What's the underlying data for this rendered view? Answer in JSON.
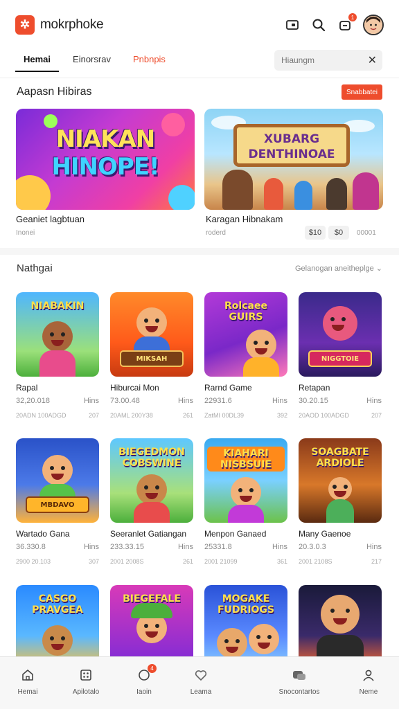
{
  "header": {
    "logo_glyph": "✲",
    "brand": "mokrphoke",
    "notification_count": "1",
    "accent": "#ee4d2d"
  },
  "tabs": [
    {
      "label": "Hemai"
    },
    {
      "label": "Einorsrav"
    },
    {
      "label": "Pnbnpis"
    }
  ],
  "search": {
    "placeholder": "Hiaungm"
  },
  "section1": {
    "title": "Aapasn Hibiras",
    "button": "Snabbatei",
    "banners": [
      {
        "art_line1": "NIAKAN",
        "art_line2": "HINOPE!",
        "title": "Geaniet lagbtuan",
        "sub": "Inonei"
      },
      {
        "art_line1": "XUBARG",
        "art_line2": "DENTHINOAE",
        "title": "Karagan Hibnakam",
        "sub": "roderd",
        "chip1": "$10",
        "chip2": "$0",
        "extra": "00001"
      }
    ]
  },
  "section2": {
    "title": "Nathgai",
    "link": "Gelanogan aneitheplge ⌄"
  },
  "games": [
    {
      "art": "NIABAKIN",
      "name": "Rapal",
      "v1": "32,20.018",
      "u1": "Hins",
      "v2": "20ADN 100ADGD",
      "u2": "207"
    },
    {
      "art": "MIKSAH",
      "name": "Hiburcai Mon",
      "v1": "73.00.48",
      "u1": "Hins",
      "v2": "20AML 200Y38",
      "u2": "261"
    },
    {
      "art": "Rolcaee GUIRS",
      "name": "Rarnd Game",
      "v1": "22931.6",
      "u1": "Hins",
      "v2": "ZatMI 00DL39",
      "u2": "392"
    },
    {
      "art": "NIGGTOIE",
      "name": "Retapan",
      "v1": "30.20.15",
      "u1": "Hins",
      "v2": "20AOD 100ADGD",
      "u2": "207"
    },
    {
      "art": "MBDAVO",
      "name": "Wartado Gana",
      "v1": "36.330.8",
      "u1": "Hins",
      "v2": "2900 20.103",
      "u2": "307"
    },
    {
      "art": "BIEGEDMON COBSWINE",
      "name": "Seeranlet Gatiangan",
      "v1": "233.33.15",
      "u1": "Hins",
      "v2": "2001 2008S",
      "u2": "261"
    },
    {
      "art": "KIAHARI NISBSUIE",
      "name": "Menpon Ganaed",
      "v1": "25331.8",
      "u1": "Hins",
      "v2": "2001 21099",
      "u2": "361"
    },
    {
      "art": "SOAGBATE ARDIOLE",
      "name": "Many Gaenoe",
      "v1": "20.3.0.3",
      "u1": "Hins",
      "v2": "2001 2108S",
      "u2": "217"
    },
    {
      "art": "CASGO PRAVGEA",
      "name": "",
      "v1": "",
      "u1": "",
      "v2": "",
      "u2": ""
    },
    {
      "art": "BIEGEFALE",
      "name": "",
      "v1": "",
      "u1": "",
      "v2": "",
      "u2": ""
    },
    {
      "art": "MOGAKE FUDRIOGS",
      "name": "",
      "v1": "",
      "u1": "",
      "v2": "",
      "u2": ""
    },
    {
      "art": "",
      "name": "",
      "v1": "",
      "u1": "",
      "v2": "",
      "u2": ""
    }
  ],
  "bottom_nav": [
    {
      "label": "Hemai",
      "icon": "home-icon"
    },
    {
      "label": "Apilotalo",
      "icon": "grid-icon"
    },
    {
      "label": "Iaoin",
      "icon": "chat-icon",
      "badge": "4"
    },
    {
      "label": "Leama",
      "icon": "heart-icon"
    },
    {
      "label": "Snocontartos",
      "icon": "gamepad-icon"
    },
    {
      "label": "Neme",
      "icon": "user-icon"
    }
  ]
}
